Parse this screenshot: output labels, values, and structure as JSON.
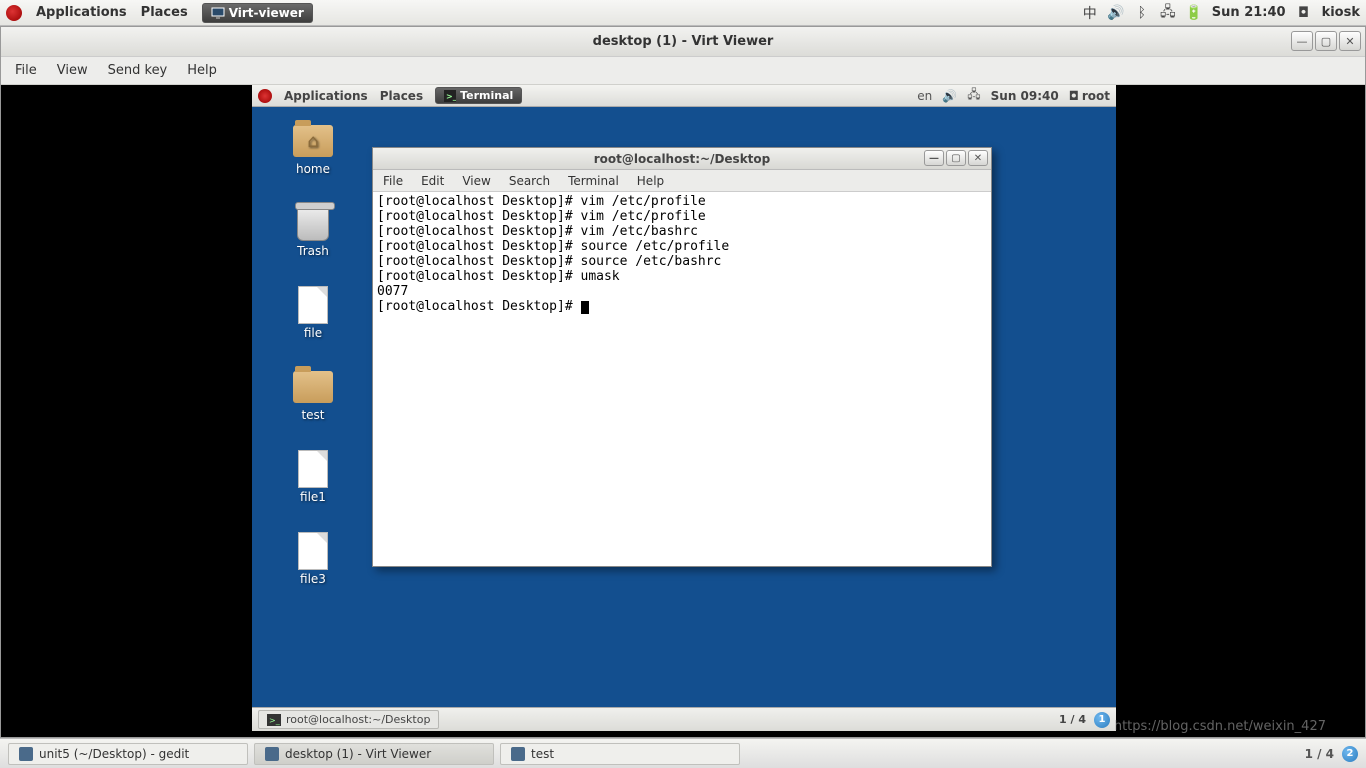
{
  "outer_panel": {
    "applications": "Applications",
    "places": "Places",
    "running_app": "Virt-viewer",
    "input_method": "中",
    "datetime": "Sun 21:40",
    "user": "kiosk"
  },
  "virt_viewer": {
    "title": "desktop (1) - Virt Viewer",
    "menu": {
      "file": "File",
      "view": "View",
      "sendkey": "Send key",
      "help": "Help"
    }
  },
  "guest_panel": {
    "applications": "Applications",
    "places": "Places",
    "running_app": "Terminal",
    "lang": "en",
    "datetime": "Sun 09:40",
    "user": "root"
  },
  "desktop_icons": [
    {
      "name": "home",
      "label": "home",
      "type": "folder-home"
    },
    {
      "name": "trash",
      "label": "Trash",
      "type": "trash"
    },
    {
      "name": "file",
      "label": "file",
      "type": "file"
    },
    {
      "name": "test",
      "label": "test",
      "type": "folder"
    },
    {
      "name": "file1",
      "label": "file1",
      "type": "file"
    },
    {
      "name": "file3",
      "label": "file3",
      "type": "file"
    }
  ],
  "terminal_window": {
    "title": "root@localhost:~/Desktop",
    "menu": {
      "file": "File",
      "edit": "Edit",
      "view": "View",
      "search": "Search",
      "terminal": "Terminal",
      "help": "Help"
    },
    "lines": [
      "[root@localhost Desktop]# vim /etc/profile",
      "[root@localhost Desktop]# vim /etc/profile",
      "[root@localhost Desktop]# vim /etc/bashrc",
      "[root@localhost Desktop]# source /etc/profile",
      "[root@localhost Desktop]# source /etc/bashrc",
      "[root@localhost Desktop]# umask",
      "0077",
      "[root@localhost Desktop]# "
    ]
  },
  "guest_taskbar": {
    "item": "root@localhost:~/Desktop",
    "pager": "1 / 4",
    "badge": "1"
  },
  "outer_taskbar": {
    "items": [
      {
        "label": "unit5 (~/Desktop) - gedit",
        "active": false
      },
      {
        "label": "desktop (1) - Virt Viewer",
        "active": true
      },
      {
        "label": "test",
        "active": false
      }
    ],
    "pager": "1 / 4",
    "badge": "2"
  },
  "watermark": "https://blog.csdn.net/weixin_427"
}
